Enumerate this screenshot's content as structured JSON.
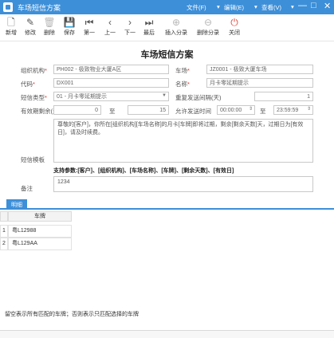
{
  "window": {
    "title": "车场短信方案",
    "menus": [
      "文件(F)",
      "编辑(E)",
      "查看(V)"
    ],
    "controls": [
      "—",
      "□",
      "✕"
    ]
  },
  "toolbar": [
    {
      "label": "新增",
      "icon": "new-doc-icon",
      "glyph": "🗋",
      "disabled": false
    },
    {
      "label": "修改",
      "icon": "edit-icon",
      "glyph": "✎",
      "disabled": false
    },
    {
      "label": "删除",
      "icon": "trash-icon",
      "glyph": "🗑",
      "disabled": true
    },
    {
      "label": "保存",
      "icon": "save-icon",
      "glyph": "💾",
      "disabled": true
    },
    {
      "label": "第一",
      "icon": "first-icon",
      "glyph": "⏮",
      "disabled": false
    },
    {
      "label": "上一",
      "icon": "prev-icon",
      "glyph": "‹",
      "disabled": false
    },
    {
      "label": "下一",
      "icon": "next-icon",
      "glyph": "›",
      "disabled": false
    },
    {
      "label": "最后",
      "icon": "last-icon",
      "glyph": "⏭",
      "disabled": false
    },
    {
      "label": "插入分录",
      "icon": "insert-row-icon",
      "glyph": "⊕",
      "disabled": true
    },
    {
      "label": "删除分录",
      "icon": "delete-row-icon",
      "glyph": "⊖",
      "disabled": true
    },
    {
      "label": "关闭",
      "icon": "power-icon",
      "glyph": "⏻",
      "disabled": false
    }
  ],
  "form": {
    "title": "车场短信方案",
    "org_label": "组织机构",
    "org_value": "PH002 - 极致物业大厦A区",
    "lot_label": "车场",
    "lot_value": "JZ0001 - 极致大厦车场",
    "code_label": "代码",
    "code_value": "DX001",
    "name_label": "名称",
    "name_value": "月卡零延期提示",
    "type_label": "短信类型",
    "type_value": "01 - 月卡零延期提示",
    "repeat_label": "重复发送间隔(天)",
    "repeat_value": "1",
    "valid_label": "有效期剩余(天)",
    "valid_from": "0",
    "valid_to_label": "至",
    "valid_to": "15",
    "time_label": "允许发送时间",
    "time_from": "00:00:00",
    "time_to_label": "至",
    "time_to": "23:59:59",
    "template_label": "短信模板",
    "template_text": "尊敬的[客户]，你所在[组织机构][车场名称]的月卡[车牌]即将过期，剩余[剩余天数]天，过期日为[有效日]，请及时续费。",
    "params_text": "支持参数:[客户]、[组织机构]、[车场名称]、[车牌]、[剩余天数]、[有效日]",
    "remark_label": "备注",
    "remark_value": "1234",
    "required_mark": "*"
  },
  "detail": {
    "tab_label": "明细",
    "column_header": "车牌",
    "rows": [
      {
        "index": "1",
        "plate": "粤L12988"
      },
      {
        "index": "2",
        "plate": "粤L129AA"
      }
    ]
  },
  "footnote": "留空表示所有匹配的车牌；否则表示只匹配选择的车牌"
}
